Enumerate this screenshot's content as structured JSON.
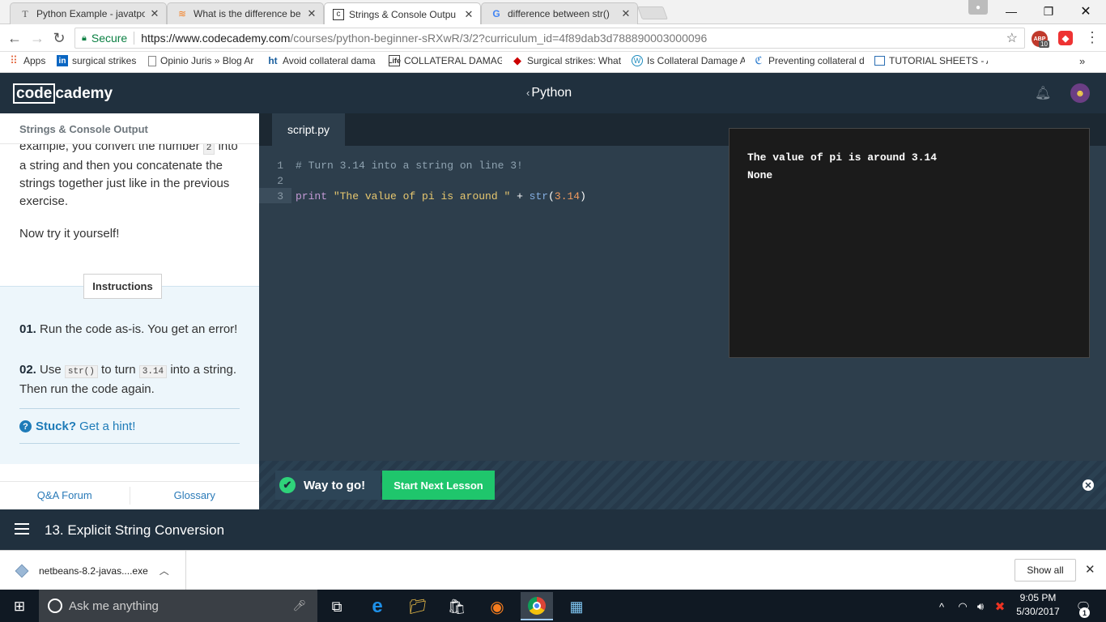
{
  "browser": {
    "tabs": [
      {
        "label": "Python Example - javatpo",
        "icon": "javatpoint-favicon"
      },
      {
        "label": "What is the difference be",
        "icon": "stackoverflow-favicon"
      },
      {
        "label": "Strings & Console Outpu",
        "icon": "codecademy-favicon",
        "active": true
      },
      {
        "label": "difference between str() ",
        "icon": "google-favicon"
      }
    ],
    "secure_label": "Secure",
    "url_host": "https://www.codecademy.com",
    "url_rest": "/courses/python-beginner-sRXwR/3/2?curriculum_id=4f89dab3d788890003000096",
    "bookmarks": [
      "Apps",
      "surgical strikes",
      "Opinio Juris » Blog Ar",
      "Avoid collateral dama",
      "COLLATERAL DAMAGE",
      "Surgical strikes: What",
      "Is Collateral Damage A",
      "Preventing collateral d",
      "TUTORIAL SHEETS - A"
    ],
    "bookmark_overflow": "»",
    "abp_count": "10"
  },
  "header": {
    "logo_box": "code",
    "logo_rest": "cademy",
    "course_link": "Python"
  },
  "lesson": {
    "section_title": "Strings & Console Output",
    "para1_a": "example, you convert the number ",
    "para1_code": "2",
    "para1_b": " into a string and then you concatenate the strings together just like in the previous exercise.",
    "para2": "Now try it yourself!",
    "instructions_tab": "Instructions",
    "step1_num": "01.",
    "step1_text": " Run the code as-is. You get an error!",
    "step2_num": "02.",
    "step2_a": " Use ",
    "step2_code1": "str()",
    "step2_b": " to turn ",
    "step2_code2": "3.14",
    "step2_c": " into a string. Then run the code again.",
    "stuck": "Stuck?",
    "hint": " Get a hint!",
    "footer_links": [
      "Q&A Forum",
      "Glossary"
    ]
  },
  "editor": {
    "file_tab": "script.py",
    "line_numbers": [
      "1",
      "2",
      "3"
    ],
    "line1_comment": "# Turn 3.14 into a string on line 3!",
    "line3_kw": "print",
    "line3_str": "\"The value of pi is around \"",
    "line3_op": " + ",
    "line3_fn": "str",
    "line3_open": "(",
    "line3_num": "3.14",
    "line3_close": ")"
  },
  "console": {
    "lines": [
      "The value of pi is around 3.14",
      "None"
    ]
  },
  "success": {
    "message": "Way to go!",
    "next_button": "Start Next Lesson"
  },
  "lesson_nav": {
    "title": "13. Explicit String Conversion"
  },
  "downloads": {
    "file": "netbeans-8.2-javas....exe",
    "show_all": "Show all"
  },
  "taskbar": {
    "search_placeholder": "Ask me anything",
    "time": "9:05 PM",
    "date": "5/30/2017",
    "notification_count": "1"
  },
  "colors": {
    "cc_header": "#20303e",
    "editor_bg": "#2d3e4c",
    "next_button": "#1fc66c",
    "link_blue": "#1e7bb8"
  }
}
